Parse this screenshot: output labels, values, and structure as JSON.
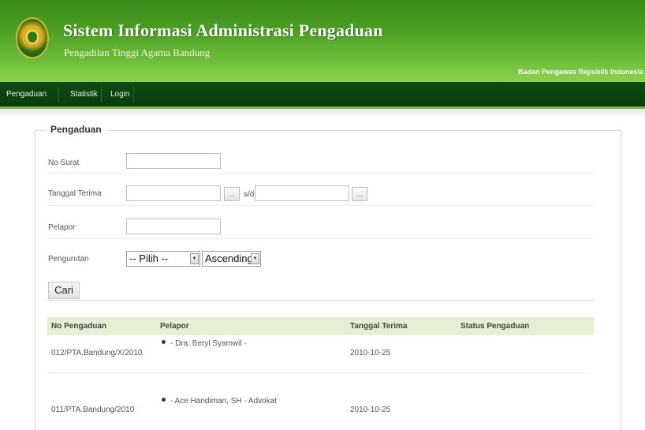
{
  "header": {
    "title": "Sistem Informasi Administrasi Pengaduan",
    "subtitle": "Pengadilan Tinggi Agama Bandung",
    "agency": "Badan Pengawas Republik Indonesia",
    "logo_icon": "court-emblem-logo"
  },
  "nav": {
    "items": [
      {
        "label": "Pengaduan"
      },
      {
        "label": "Statistik"
      },
      {
        "label": "Login"
      }
    ]
  },
  "form": {
    "legend": "Pengaduan",
    "no_surat": {
      "label": "No Surat",
      "value": ""
    },
    "tanggal_terima": {
      "label": "Tanggal Terima",
      "from_value": "",
      "to_value": "",
      "separator": "s/d",
      "picker_label": "..."
    },
    "pelapor": {
      "label": "Pelapor",
      "value": ""
    },
    "pengurutan": {
      "label": "Pengurutan",
      "field_selected": "-- Pilih --",
      "order_selected": "Ascending"
    },
    "search_button": "Cari"
  },
  "table": {
    "columns": [
      "No Pengaduan",
      "Pelapor",
      "Tanggal Terima",
      "Status Pengaduan"
    ],
    "rows": [
      {
        "no": "012/PTA.Bandung/X/2010",
        "pelapor": "- Dra. Beryl Syamwil -",
        "tanggal": "2010-10-25",
        "status": ""
      },
      {
        "no": "011/PTA.Bandung/2010",
        "pelapor": "- Ace Handiman, SH - Advokat",
        "tanggal": "2010-10-25",
        "status": ""
      }
    ]
  },
  "colors": {
    "header_green": "#4a9e22",
    "nav_dark_green": "#0a3d0f",
    "table_header_bg": "#e4efd3"
  }
}
